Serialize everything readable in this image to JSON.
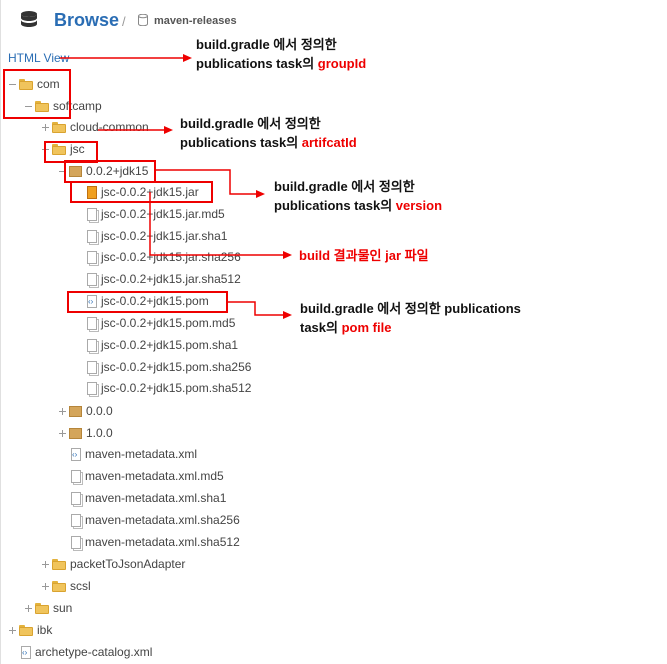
{
  "header": {
    "title": "Browse",
    "separator": "/",
    "repo": "maven-releases"
  },
  "html_view": "HTML View",
  "tree": [
    {
      "label": "com"
    },
    {
      "label": "softcamp"
    },
    {
      "label": "cloud-common"
    },
    {
      "label": "jsc"
    },
    {
      "label": "0.0.2+jdk15"
    },
    {
      "label": "jsc-0.0.2+jdk15.jar"
    },
    {
      "label": "jsc-0.0.2+jdk15.jar.md5"
    },
    {
      "label": "jsc-0.0.2+jdk15.jar.sha1"
    },
    {
      "label": "jsc-0.0.2+jdk15.jar.sha256"
    },
    {
      "label": "jsc-0.0.2+jdk15.jar.sha512"
    },
    {
      "label": "jsc-0.0.2+jdk15.pom"
    },
    {
      "label": "jsc-0.0.2+jdk15.pom.md5"
    },
    {
      "label": "jsc-0.0.2+jdk15.pom.sha1"
    },
    {
      "label": "jsc-0.0.2+jdk15.pom.sha256"
    },
    {
      "label": "jsc-0.0.2+jdk15.pom.sha512"
    },
    {
      "label": "0.0.0"
    },
    {
      "label": "1.0.0"
    },
    {
      "label": "maven-metadata.xml"
    },
    {
      "label": "maven-metadata.xml.md5"
    },
    {
      "label": "maven-metadata.xml.sha1"
    },
    {
      "label": "maven-metadata.xml.sha256"
    },
    {
      "label": "maven-metadata.xml.sha512"
    },
    {
      "label": "packetToJsonAdapter"
    },
    {
      "label": "scsl"
    },
    {
      "label": "sun"
    },
    {
      "label": "ibk"
    },
    {
      "label": "archetype-catalog.xml"
    }
  ],
  "annotations": {
    "group": {
      "line1": "build.gradle  에서 정의한",
      "line2a": "publications  task의 ",
      "line2b": "groupId"
    },
    "artifact": {
      "line1": "build.gradle  에서 정의한",
      "line2a": "publications  task의 ",
      "line2b": "artifcatId"
    },
    "version": {
      "line1": "build.gradle  에서 정의한",
      "line2a": "publications  task의 ",
      "line2b": "version"
    },
    "jar": {
      "text": "build  결과물인 jar  파일"
    },
    "pom": {
      "line1": "build.gradle  에서 정의한 publications",
      "line2a": "task의  ",
      "line2b": "pom file"
    }
  },
  "colors": {
    "accent": "#2a6db4",
    "annotation": "#e00000"
  }
}
